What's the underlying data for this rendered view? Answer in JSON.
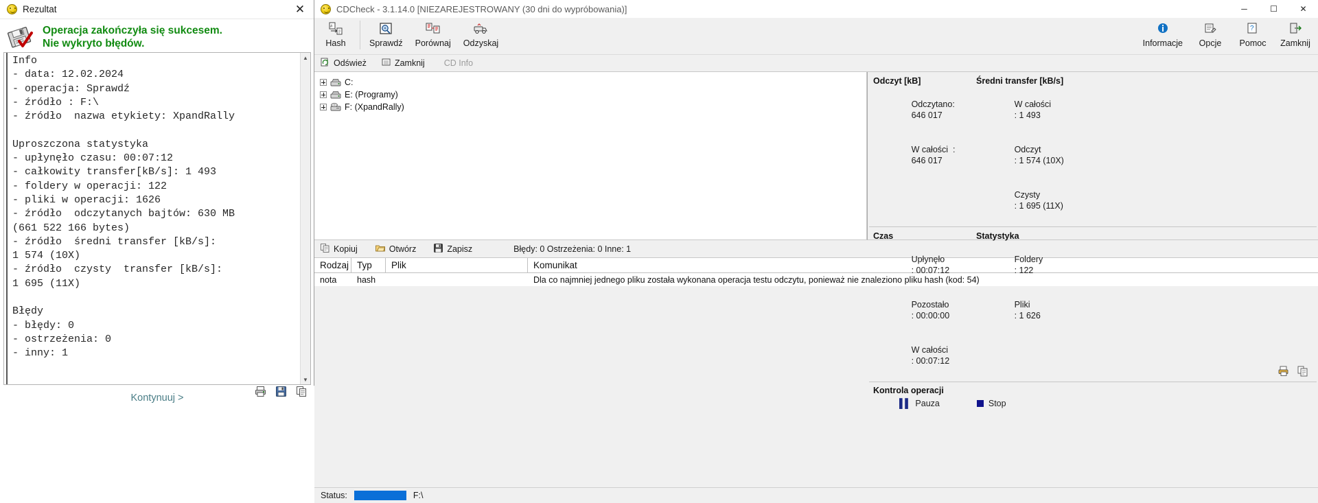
{
  "left_window": {
    "title": "Rezultat",
    "title_icon": "sun-smiley-icon",
    "close_label": "✕",
    "result_heading": "Operacja zakończyła się sukcesem.\nNie wykryto błędów.",
    "result_color": "#128b12",
    "report_text": "Info\n- data: 12.02.2024\n- operacja: Sprawdź\n- źródło : F:\\\n- źródło  nazwa etykiety: XpandRally\n\nUproszczona statystyka\n- upłynęło czasu: 00:07:12\n- całkowity transfer[kB/s]: 1 493\n- foldery w operacji: 122\n- pliki w operacji: 1626\n- źródło  odczytanych bajtów: 630 MB\n(661 522 166 bytes)\n- źródło  średni transfer [kB/s]:\n1 574 (10X)\n- źródło  czysty  transfer [kB/s]:\n1 695 (11X)\n\nBłędy\n- błędy: 0\n- ostrzeżenia: 0\n- inny: 1",
    "continue_label": "Kontynuuj >",
    "bottom_icons": [
      "print-icon",
      "save-icon",
      "copy-icon"
    ]
  },
  "right_window": {
    "title": "CDCheck - 3.1.14.0 [NIEZAREJESTROWANY (30 dni do wypróbowania)]",
    "title_icon": "sun-smiley-icon",
    "window_controls": {
      "minimize": "─",
      "maximize": "☐",
      "close": "✕"
    },
    "ribbon_left": [
      {
        "label": "Hash",
        "accel": "H",
        "icon": "hash-file-icon"
      },
      {
        "label": "Sprawdź",
        "accel": "S",
        "icon": "magnifier-disc-icon"
      },
      {
        "label": "Porównaj",
        "accel": "o",
        "icon": "compare-files-icon"
      },
      {
        "label": "Odzyskaj",
        "accel": "s",
        "icon": "recovery-truck-icon"
      }
    ],
    "ribbon_right": [
      {
        "label": "Informacje",
        "accel": "I",
        "icon": "info-circle-icon"
      },
      {
        "label": "Opcje",
        "accel": "O",
        "icon": "options-icon"
      },
      {
        "label": "Pomoc",
        "accel": "P",
        "icon": "help-icon"
      },
      {
        "label": "Zamknij",
        "accel": "Z",
        "icon": "exit-door-icon"
      }
    ],
    "subbar": [
      {
        "label": "Odśwież",
        "icon": "refresh-icon",
        "disabled": false
      },
      {
        "label": "Zamknij",
        "icon": "eject-icon",
        "disabled": false
      },
      {
        "label": "CD Info",
        "icon": "cd-info-icon",
        "disabled": true
      }
    ],
    "tree": [
      {
        "label": "C:",
        "icon": "hdd-icon"
      },
      {
        "label": "E: (Programy)",
        "icon": "hdd-icon"
      },
      {
        "label": "F: (XpandRally)",
        "icon": "cd-drive-icon"
      }
    ],
    "stats": {
      "read": {
        "heading": "Odczyt [kB]",
        "rows": [
          {
            "label": "Odczytano:",
            "value": "646 017"
          },
          {
            "label": "W całości  :",
            "value": "646 017"
          }
        ]
      },
      "avg_transfer": {
        "heading": "Średni transfer [kB/s]",
        "rows": [
          {
            "label": "W całości",
            "value": ": 1 493"
          },
          {
            "label": "Odczyt   ",
            "value": ": 1 574 (10X)"
          },
          {
            "label": "Czysty   ",
            "value": ": 1 695 (11X)"
          }
        ]
      },
      "time": {
        "heading": "Czas",
        "rows": [
          {
            "label": "Upłynęło",
            "value": ": 00:07:12"
          },
          {
            "label": "Pozostało",
            "value": ": 00:00:00"
          },
          {
            "label": "W całości",
            "value": ": 00:07:12"
          }
        ]
      },
      "statistics": {
        "heading": "Statystyka",
        "rows": [
          {
            "label": "Foldery",
            "value": ": 122"
          },
          {
            "label": "Pliki",
            "value": ": 1 626"
          }
        ]
      },
      "icons": [
        "print-icon",
        "copy-icon"
      ]
    },
    "operation_control": {
      "heading": "Kontrola operacji",
      "pause_label": "Pauza",
      "stop_label": "Stop"
    },
    "log_toolbar": [
      {
        "label": "Kopiuj",
        "icon": "copy-icon"
      },
      {
        "label": "Otwórz",
        "icon": "open-folder-icon"
      },
      {
        "label": "Zapisz",
        "icon": "save-disk-icon"
      }
    ],
    "log_counts": "Błędy: 0 Ostrzeżenia: 0 Inne: 1",
    "log_columns": [
      "Rodzaj",
      "Typ",
      "Plik",
      "Komunikat"
    ],
    "log_rows": [
      {
        "rodzaj": "nota",
        "typ": "hash",
        "plik": "",
        "komunikat": "Dla co najmniej jednego pliku została wykonana operacja testu odczytu, ponieważ nie znaleziono pliku hash (kod: 54)"
      }
    ],
    "statusbar": {
      "label": "Status:",
      "progress_percent": 100,
      "progress_color": "#0a6fd8",
      "value": "F:\\"
    }
  }
}
